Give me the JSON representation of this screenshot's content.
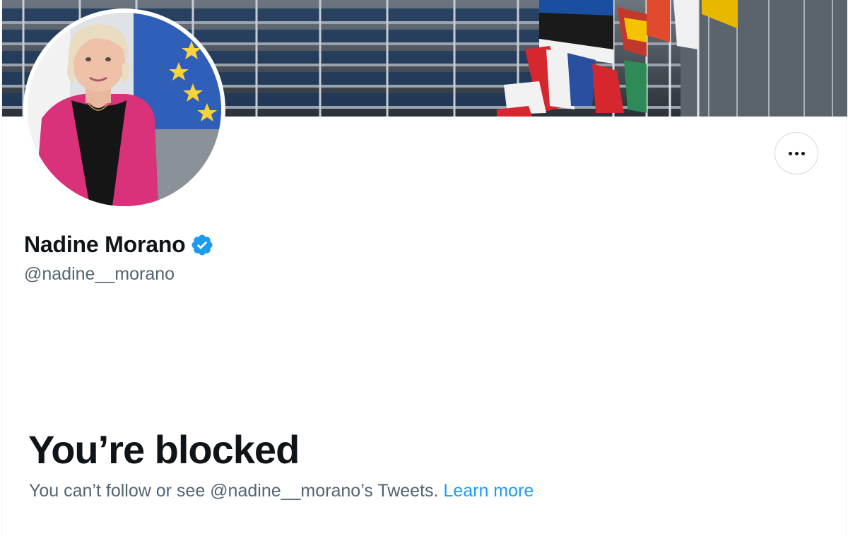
{
  "profile": {
    "display_name": "Nadine Morano",
    "handle": "@nadine__morano"
  },
  "icons": {
    "verified": "verified-badge-icon",
    "more": "more-options-icon"
  },
  "blocked": {
    "title": "You’re blocked",
    "message": "You can’t follow or see @nadine__morano’s Tweets.",
    "link_label": "Learn more"
  },
  "colors": {
    "accent": "#1d9bf0",
    "text_primary": "#0f1419",
    "text_secondary": "#536471",
    "border": "#cfd9de"
  }
}
